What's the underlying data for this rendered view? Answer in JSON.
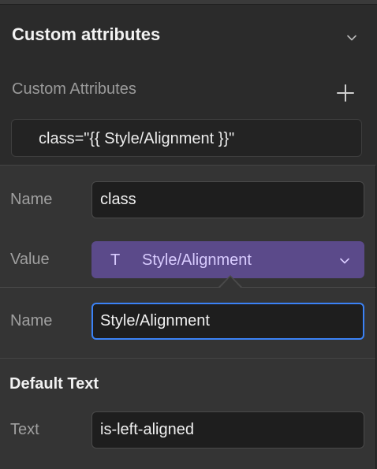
{
  "section": {
    "title": "Custom attributes",
    "subtitle": "Custom Attributes",
    "attribute_item": "class=\"{{ Style/Alignment }}\""
  },
  "attribute_editor": {
    "name_label": "Name",
    "name_value": "class",
    "value_label": "Value",
    "value_type_icon": "T",
    "value_selected": "Style/Alignment"
  },
  "variable_editor": {
    "name_label": "Name",
    "name_value": "Style/Alignment",
    "default_heading": "Default Text",
    "text_label": "Text",
    "text_value": "is-left-aligned"
  },
  "icons": [
    "chevron-down-icon",
    "plus-icon",
    "text-type-icon",
    "chevron-down-icon"
  ],
  "colors": {
    "accent_purple": "#5b4a8a",
    "focus_blue": "#3b82f6",
    "background": "#2b2b2b"
  }
}
